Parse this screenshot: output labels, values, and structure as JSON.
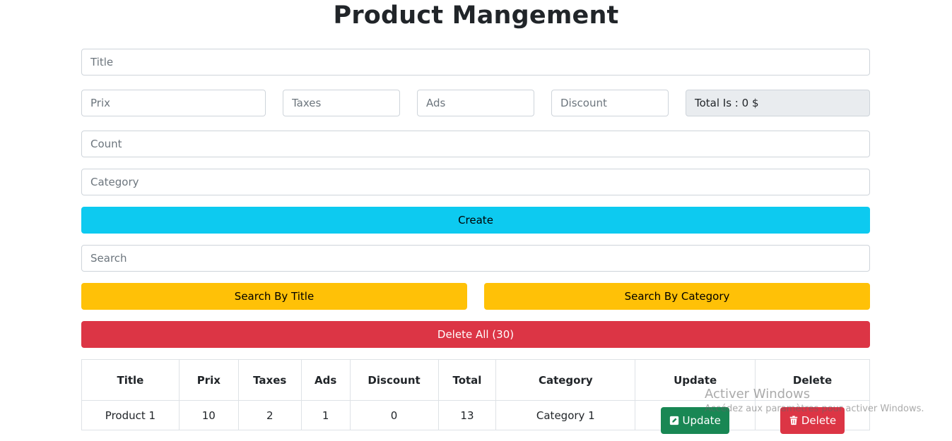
{
  "header": {
    "title": "Product Mangement"
  },
  "form": {
    "title_placeholder": "Title",
    "price_placeholder": "Prix",
    "taxes_placeholder": "Taxes",
    "ads_placeholder": "Ads",
    "discount_placeholder": "Discount",
    "total_label": "Total Is : 0 $",
    "count_placeholder": "Count",
    "category_placeholder": "Category",
    "create_label": "Create"
  },
  "search": {
    "placeholder": "Search",
    "by_title_label": "Search By Title",
    "by_category_label": "Search By Category"
  },
  "delete_all_label": "Delete All (30)",
  "table": {
    "columns": [
      "Title",
      "Prix",
      "Taxes",
      "Ads",
      "Discount",
      "Total",
      "Category",
      "Update",
      "Delete"
    ],
    "rows": [
      {
        "title": "Product 1",
        "price": "10",
        "taxes": "2",
        "ads": "1",
        "discount": "0",
        "total": "13",
        "category": "Category 1",
        "update_label": "Update",
        "delete_label": "Delete"
      }
    ]
  },
  "watermark": {
    "line1": "Activer Windows",
    "line2": "Accédez aux paramètres pour activer Windows."
  },
  "colors": {
    "info": "#0dcaf0",
    "warning": "#ffc107",
    "danger": "#dc3545",
    "success": "#198754"
  },
  "icons": {
    "update_icon": "edit-square-icon",
    "delete_icon": "trash-icon"
  }
}
